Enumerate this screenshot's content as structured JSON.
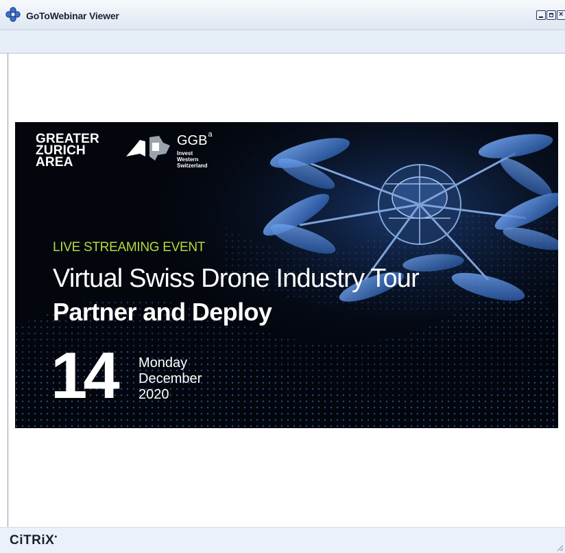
{
  "window": {
    "title": "GoToWebinar Viewer",
    "controls": [
      "minimize",
      "maximize",
      "close"
    ]
  },
  "slide": {
    "logo_gza": [
      "GREATER",
      "ZURICH",
      "AREA"
    ],
    "ggb": {
      "name": "GGB",
      "superscript": "a",
      "sub": [
        "Invest",
        "Western",
        "Switzerland"
      ]
    },
    "event_type": "LIVE STREAMING EVENT",
    "title": "Virtual Swiss Drone Industry Tour",
    "subtitle": "Partner and Deploy",
    "date": {
      "day": "14",
      "weekday": "Monday",
      "month": "December",
      "year": "2020"
    }
  },
  "footer": {
    "brand": "CiTRiX"
  },
  "colors": {
    "accent_green": "#b8d93a",
    "slide_bg": "#03060d",
    "drone_blue": "#3a7fd8",
    "window_bar": "#dfe7f2"
  },
  "icons": {
    "app": "gotowebinar-flower-icon",
    "minimize": "minimize-icon",
    "maximize": "maximize-icon",
    "close": "close-icon"
  }
}
